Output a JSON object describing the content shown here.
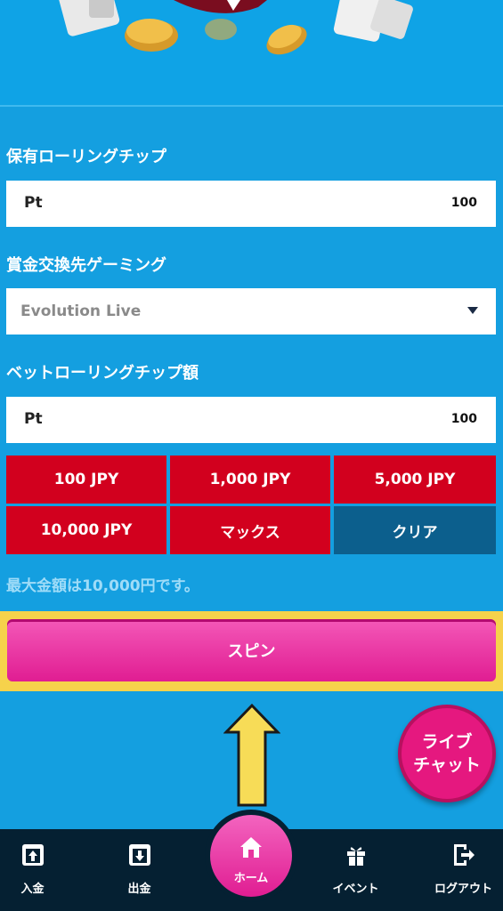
{
  "rolling_chip": {
    "label": "保有ローリングチップ",
    "unit": "Pt",
    "value": "100"
  },
  "game_select": {
    "label": "賞金交換先ゲーミング",
    "selected": "Evolution Live"
  },
  "bet_chip": {
    "label": "ベットローリングチップ額",
    "unit": "Pt",
    "value": "100"
  },
  "amount_buttons": [
    "100 JPY",
    "1,000 JPY",
    "5,000 JPY",
    "10,000 JPY",
    "マックス",
    "クリア"
  ],
  "note": "最大金額は10,000円です。",
  "spin_label": "スピン",
  "live_chat": {
    "line1": "ライブ",
    "line2": "チャット"
  },
  "nav": {
    "deposit": "入金",
    "withdraw": "出金",
    "home": "ホーム",
    "event": "イベント",
    "logout": "ログアウト"
  },
  "colors": {
    "accent_red": "#d2001e",
    "spin_pink": "#e01d92",
    "background": "#149fe0",
    "nav": "#052032"
  }
}
